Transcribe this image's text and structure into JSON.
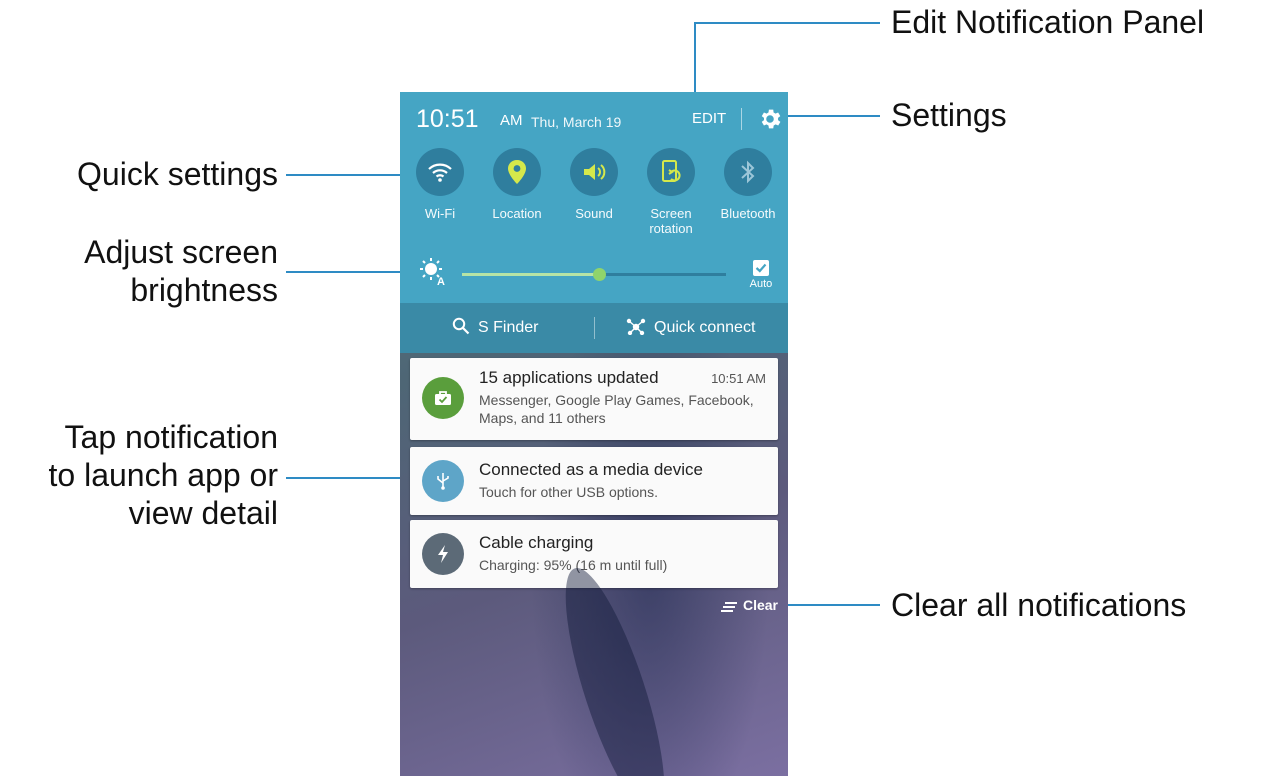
{
  "callouts": {
    "edit_panel": "Edit Notification Panel",
    "settings": "Settings",
    "quick_settings": "Quick settings",
    "brightness_line1": "Adjust screen",
    "brightness_line2": "brightness",
    "tap_line1": "Tap notification",
    "tap_line2": "to launch app or",
    "tap_line3": "view detail",
    "clear_all": "Clear all notifications"
  },
  "status": {
    "time": "10:51",
    "ampm": "AM",
    "date": "Thu, March 19",
    "edit": "EDIT",
    "settings_icon": "gear-icon"
  },
  "quick_settings": [
    {
      "label": "Wi-Fi",
      "icon": "wifi-icon"
    },
    {
      "label": "Location",
      "icon": "location-pin-icon"
    },
    {
      "label": "Sound",
      "icon": "speaker-icon"
    },
    {
      "label_line1": "Screen",
      "label_line2": "rotation",
      "icon": "screen-rotation-icon"
    },
    {
      "label": "Bluetooth",
      "icon": "bluetooth-icon"
    }
  ],
  "brightness": {
    "level_fraction": 0.52,
    "auto_label": "Auto",
    "auto_checked": true
  },
  "finder_bar": {
    "s_finder": "S Finder",
    "quick_connect": "Quick connect"
  },
  "notifications": [
    {
      "title": "15 applications updated",
      "time": "10:51 AM",
      "body_line1": "Messenger, Google Play Games, Facebook,",
      "body_line2": "Maps, and 11 others",
      "icon": "briefcase-check-icon",
      "color": "#5a9e3c"
    },
    {
      "title": "Connected as a media device",
      "body": "Touch for other USB options.",
      "icon": "usb-icon",
      "color": "#5ea5c8"
    },
    {
      "title": "Cable charging",
      "body": "Charging: 95% (16 m until full)",
      "icon": "lightning-icon",
      "color": "#5c6a77"
    }
  ],
  "clear": "Clear",
  "colors": {
    "accent_yellow": "#d5e84b",
    "panel_blue": "#45a5c4",
    "leader_blue": "#2e8bc4"
  }
}
